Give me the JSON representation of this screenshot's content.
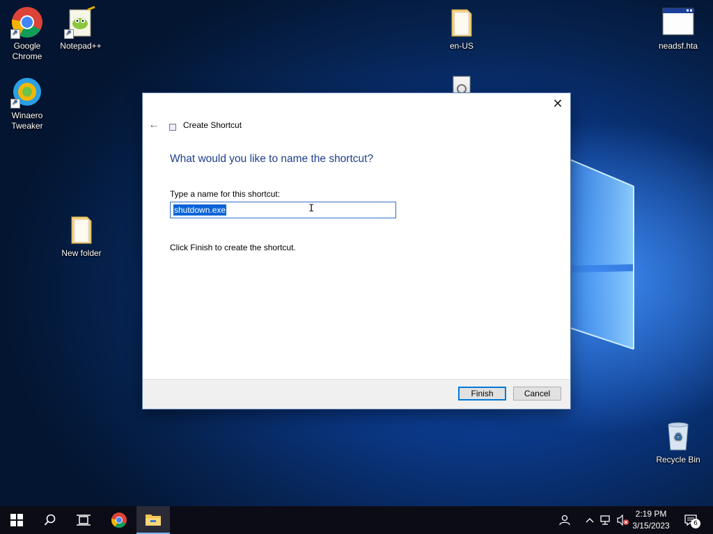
{
  "desktop": {
    "icons": [
      {
        "label": "Google\nChrome"
      },
      {
        "label": "Notepad++"
      },
      {
        "label": "Winaero\nTweaker"
      },
      {
        "label": "New folder"
      },
      {
        "label": "en-US"
      },
      {
        "label": "neadsf.hta"
      },
      {
        "label": "Recycle Bin"
      }
    ]
  },
  "dialog": {
    "title": "Create Shortcut",
    "heading": "What would you like to name the shortcut?",
    "field_label": "Type a name for this shortcut:",
    "field_value": "shutdown.exe",
    "hint": "Click Finish to create the shortcut.",
    "finish_label": "Finish",
    "cancel_label": "Cancel",
    "close_glyph": "✕",
    "back_glyph": "←"
  },
  "taskbar": {
    "clock_time": "2:19 PM",
    "clock_date": "3/15/2023",
    "notification_count": "6"
  },
  "colors": {
    "accent": "#0078d7",
    "heading": "#1e3f8a",
    "selection": "#0a64d8"
  }
}
